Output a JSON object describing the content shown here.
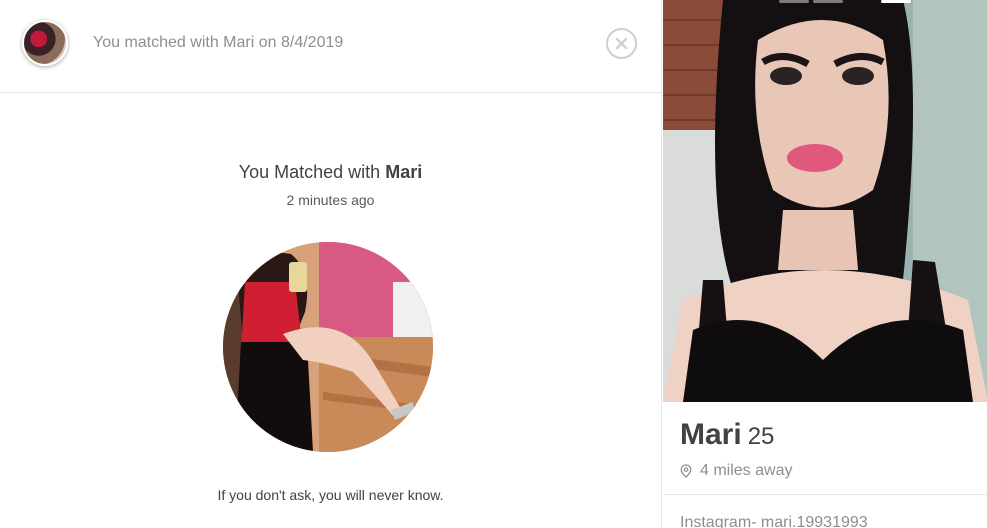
{
  "header": {
    "text_prefix": "You matched with",
    "name": "Mari",
    "text_on": "on",
    "date": "8/4/2019"
  },
  "match": {
    "title_prefix": "You Matched with",
    "name": "Mari",
    "time_ago": "2 minutes ago",
    "bio": "If you don't ask, you will never know."
  },
  "profile": {
    "name": "Mari",
    "age": "25",
    "distance": "4 miles away",
    "instagram": "Instagram- mari.19931993"
  },
  "icons": {
    "close": "close-icon",
    "location": "location-pin-icon"
  },
  "colors": {
    "text_dark": "#424242",
    "text_muted": "#8e8e8e",
    "border": "#e6e6e6"
  }
}
